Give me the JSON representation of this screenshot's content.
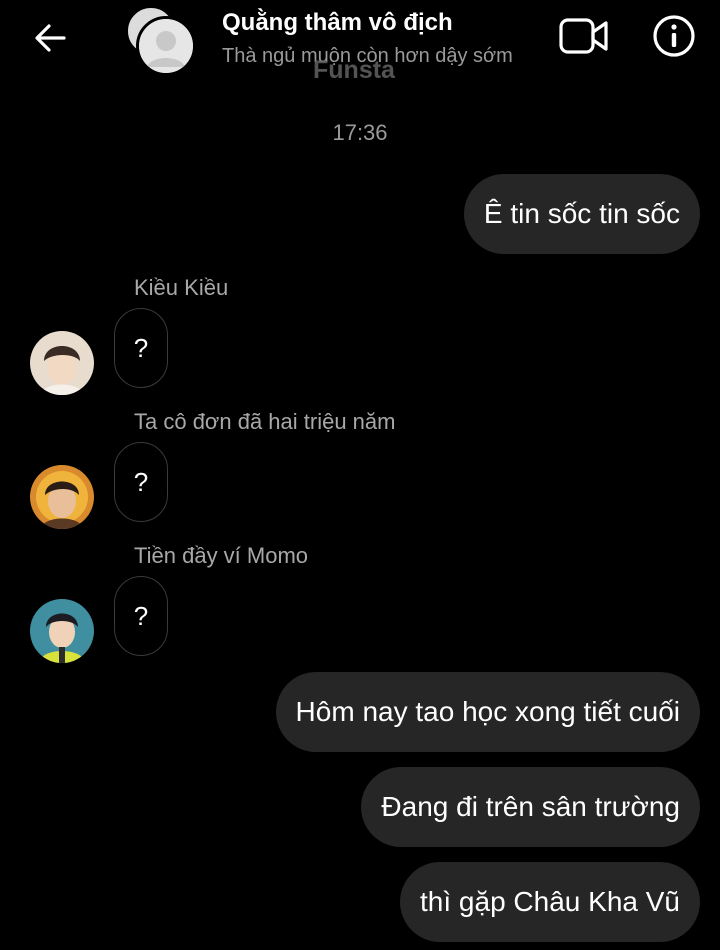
{
  "header": {
    "title": "Quằng thâm vô địch",
    "subtitle": "Thà ngủ muộn còn hơn dậy sớm",
    "watermark": "Funsta",
    "icons": {
      "back": "back-arrow-icon",
      "video": "video-camera-icon",
      "info": "info-icon",
      "avatar": "group-avatar-icon"
    }
  },
  "timestamp": "17:36",
  "messages": [
    {
      "type": "outgoing",
      "text": "Ê tin sốc tin sốc"
    },
    {
      "type": "incoming",
      "sender": "Kiều Kiều",
      "text": "?"
    },
    {
      "type": "incoming",
      "sender": "Ta cô đơn đã hai triệu năm",
      "text": "?"
    },
    {
      "type": "incoming",
      "sender": "Tiền đầy ví Momo",
      "text": "?"
    },
    {
      "type": "outgoing",
      "text": "Hôm nay tao học xong tiết cuối"
    },
    {
      "type": "outgoing",
      "text": "Đang đi trên sân trường"
    },
    {
      "type": "outgoing",
      "text": "thì gặp Châu Kha Vũ"
    }
  ],
  "colors": {
    "background": "#000000",
    "bubble_outgoing": "#262626",
    "bubble_incoming_border": "#3a3a3a",
    "secondary_text": "#9a9a9a"
  }
}
